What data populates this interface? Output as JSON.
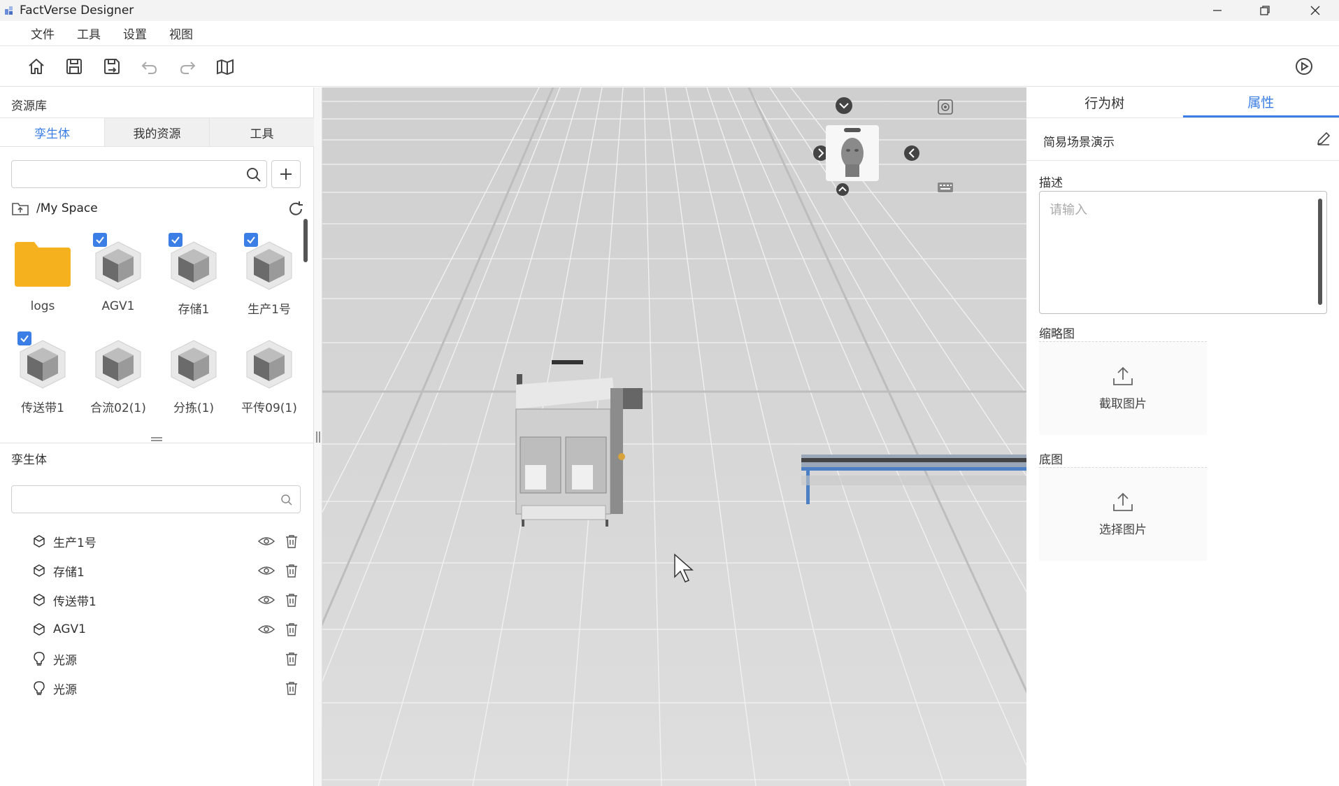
{
  "window": {
    "title": "FactVerse Designer"
  },
  "menu": [
    "文件",
    "工具",
    "设置",
    "视图"
  ],
  "left": {
    "library_title": "资源库",
    "tabs": [
      "孪生体",
      "我的资源",
      "工具"
    ],
    "path": "/My Space",
    "grid": [
      {
        "label": "logs",
        "type": "folder",
        "checked": false
      },
      {
        "label": "AGV1",
        "type": "cube",
        "checked": true
      },
      {
        "label": "存储1",
        "type": "cube",
        "checked": true
      },
      {
        "label": "生产1号",
        "type": "cube",
        "checked": true
      },
      {
        "label": "传送带1",
        "type": "cube",
        "checked": true
      },
      {
        "label": "合流02(1)",
        "type": "cube",
        "checked": false
      },
      {
        "label": "分拣(1)",
        "type": "cube",
        "checked": false
      },
      {
        "label": "平传09(1)",
        "type": "cube",
        "checked": false
      }
    ],
    "twins_title": "孪生体",
    "tree": [
      {
        "label": "生产1号",
        "icon": "cube-icon",
        "visible": true
      },
      {
        "label": "存储1",
        "icon": "cube-icon",
        "visible": true
      },
      {
        "label": "传送带1",
        "icon": "cube-icon",
        "visible": true
      },
      {
        "label": "AGV1",
        "icon": "cube-icon",
        "visible": true
      },
      {
        "label": "光源",
        "icon": "bulb-icon",
        "visible": false
      },
      {
        "label": "光源",
        "icon": "bulb-icon",
        "visible": false
      }
    ]
  },
  "right": {
    "tabs": [
      "行为树",
      "属性"
    ],
    "scene_name": "简易场景演示",
    "desc_label": "描述",
    "desc_placeholder": "请输入",
    "thumb_label": "缩略图",
    "thumb_action": "截取图片",
    "base_label": "底图",
    "base_action": "选择图片"
  }
}
